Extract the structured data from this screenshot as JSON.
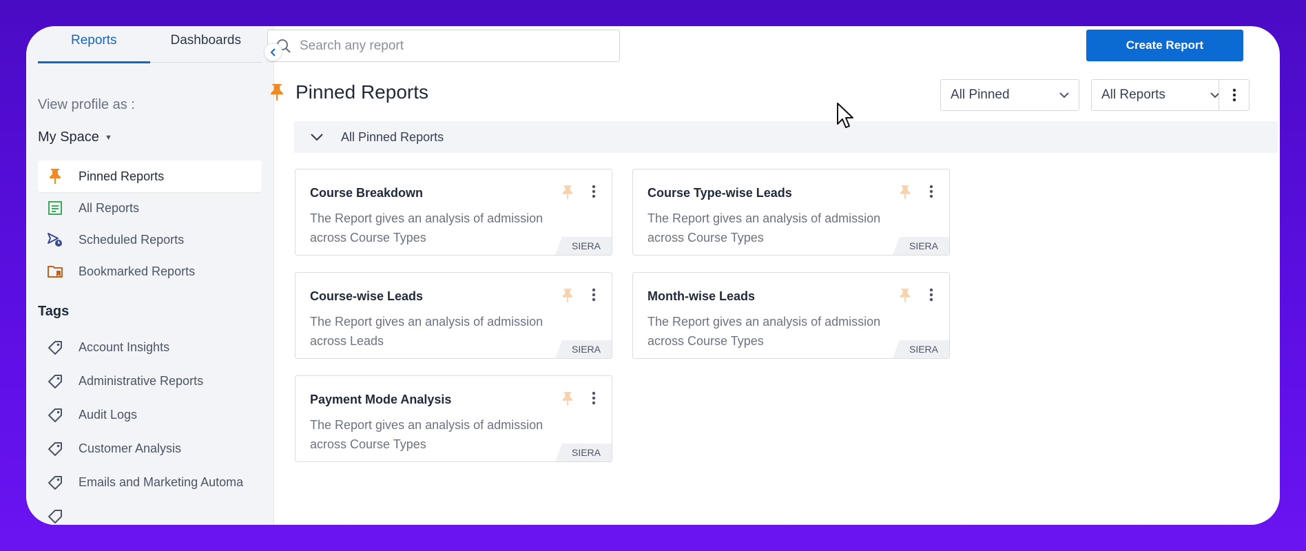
{
  "sidebar": {
    "tabs": [
      {
        "label": "Reports",
        "active": true
      },
      {
        "label": "Dashboards",
        "active": false
      }
    ],
    "view_profile_label": "View profile as :",
    "space_label": "My Space",
    "nav": [
      {
        "label": "Pinned Reports",
        "icon": "pin-icon",
        "active": true
      },
      {
        "label": "All Reports",
        "icon": "report-list-icon",
        "active": false
      },
      {
        "label": "Scheduled Reports",
        "icon": "scheduled-icon",
        "active": false
      },
      {
        "label": "Bookmarked Reports",
        "icon": "bookmark-folder-icon",
        "active": false
      }
    ],
    "tags_heading": "Tags",
    "tags": [
      "Account Insights",
      "Administrative Reports",
      "Audit Logs",
      "Customer Analysis",
      "Emails and Marketing Automa"
    ]
  },
  "toolbar": {
    "search_placeholder": "Search any report",
    "create_label": "Create Report",
    "filter_pinned": "All Pinned",
    "filter_reports": "All Reports"
  },
  "page": {
    "title": "Pinned Reports",
    "section_label": "All Pinned Reports"
  },
  "cards": [
    {
      "title": "Course Breakdown",
      "desc": "The Report gives an analysis of admission across Course Types",
      "badge": "SIERA"
    },
    {
      "title": "Course Type-wise Leads",
      "desc": "The Report gives an analysis of admission across Course Types",
      "badge": "SIERA"
    },
    {
      "title": "Course-wise Leads",
      "desc": "The Report gives an analysis of admission across Leads",
      "badge": "SIERA"
    },
    {
      "title": "Month-wise Leads",
      "desc": "The Report gives an analysis of admission across Course Types",
      "badge": "SIERA"
    },
    {
      "title": "Payment Mode Analysis",
      "desc": "The Report gives an analysis of admission across Course Types",
      "badge": "SIERA"
    }
  ],
  "colors": {
    "accent": "#0b6bd3",
    "pin": "#f08a24",
    "pin_faded": "#f7d3ad",
    "background_gradient_top": "#4a0bc4",
    "background_gradient_bottom": "#6a14f2"
  }
}
